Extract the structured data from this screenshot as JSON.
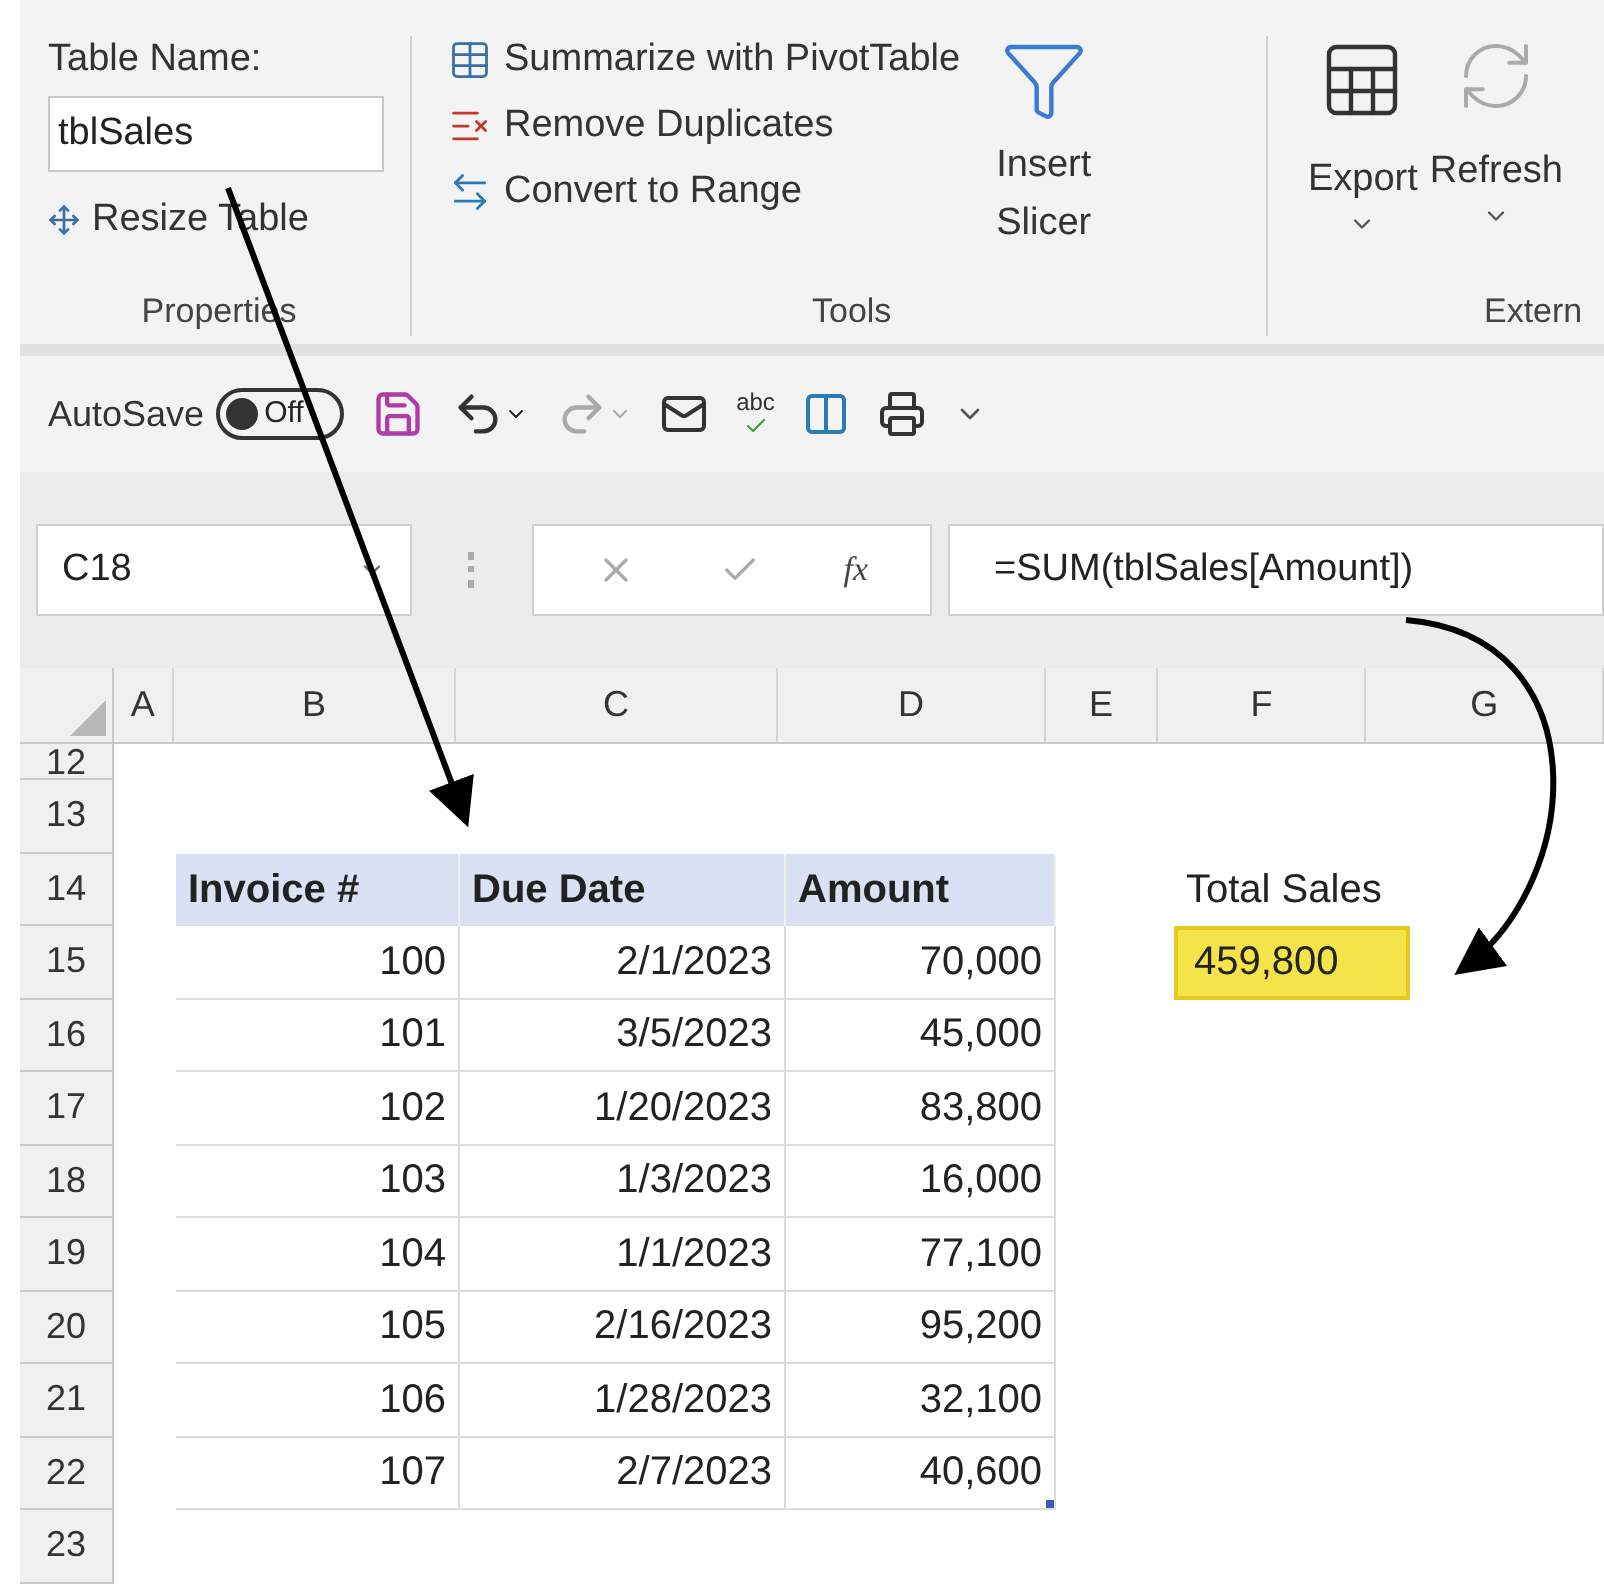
{
  "ribbon": {
    "table_name_label": "Table Name:",
    "table_name_value": "tblSales",
    "resize_label": "Resize Table",
    "tools": [
      "Summarize with PivotTable",
      "Remove Duplicates",
      "Convert to Range"
    ],
    "slicer_lines": [
      "Insert",
      "Slicer"
    ],
    "external": [
      {
        "label": "Export",
        "kind": "export"
      },
      {
        "label": "Refresh",
        "kind": "refresh"
      }
    ],
    "groups": [
      "Properties",
      "Tools",
      "Extern"
    ]
  },
  "quick_access": {
    "autosave_label": "AutoSave",
    "autosave_on": false,
    "toggle_text": "Off",
    "spelling_label": "abc"
  },
  "formula_bar": {
    "name_box": "C18",
    "function_label": "fx",
    "formula": "=SUM(tblSales[Amount])"
  },
  "sheet": {
    "columns": [
      "A",
      "B",
      "C",
      "D",
      "E",
      "F",
      "G"
    ],
    "row_numbers": [
      "12",
      "13",
      "14",
      "15",
      "16",
      "17",
      "18",
      "19",
      "20",
      "21",
      "22",
      "23"
    ],
    "table": {
      "columns": [
        "Invoice #",
        "Due Date",
        "Amount"
      ],
      "rows": [
        [
          "100",
          "2/1/2023",
          "70,000"
        ],
        [
          "101",
          "3/5/2023",
          "45,000"
        ],
        [
          "102",
          "1/20/2023",
          "83,800"
        ],
        [
          "103",
          "1/3/2023",
          "16,000"
        ],
        [
          "104",
          "1/1/2023",
          "77,100"
        ],
        [
          "105",
          "2/16/2023",
          "95,200"
        ],
        [
          "106",
          "1/28/2023",
          "32,100"
        ],
        [
          "107",
          "2/7/2023",
          "40,600"
        ]
      ]
    },
    "total_label": "Total Sales",
    "total_value": "459,800"
  }
}
